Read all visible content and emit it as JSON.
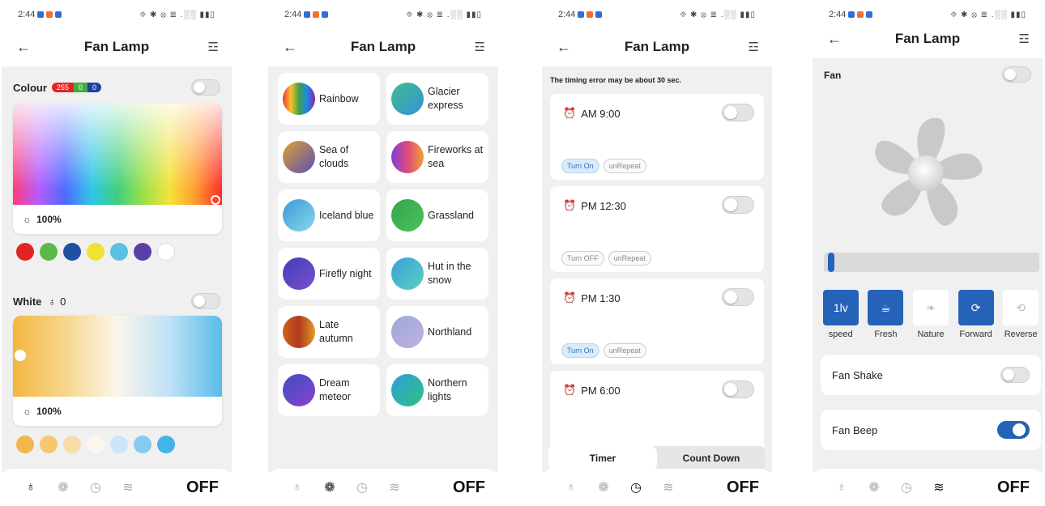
{
  "status": {
    "time": "2:44",
    "icons": "⯑ ✱ ⦻ ≣ .░░ ▮▮▯"
  },
  "app": {
    "title": "Fan Lamp",
    "back_icon": "←",
    "tune_icon": "☲"
  },
  "bottom_nav": {
    "items": [
      "bulb-icon",
      "palette-icon",
      "timer-icon",
      "fan-icon"
    ],
    "off_label": "OFF"
  },
  "color_panel": {
    "colour_label": "Colour",
    "rgb": {
      "r": "255",
      "g": "0",
      "b": "0"
    },
    "colour_brightness": "100%",
    "colour_swatches": [
      "#e32424",
      "#5bb947",
      "#1f4fa0",
      "#f0e233",
      "#5cc0e0",
      "#5a3fa8",
      "#ffffff"
    ],
    "white_label": "White",
    "white_value": "0",
    "white_brightness": "100%",
    "white_swatches": [
      "#f2b64a",
      "#f5c870",
      "#f5dca8",
      "#fbf7ee",
      "#c8e6f6",
      "#86cbee",
      "#45b3e8"
    ]
  },
  "scenes_panel": {
    "scenes": [
      {
        "name": "Rainbow",
        "colors": [
          "#e53935",
          "#fbc02d",
          "#43a047",
          "#1e88e5",
          "#8e24aa"
        ]
      },
      {
        "name": "Glacier express",
        "colors": [
          "#3bbf8a",
          "#3a8fd8"
        ]
      },
      {
        "name": "Sea of clouds",
        "colors": [
          "#e0a030",
          "#5a4fb8"
        ]
      },
      {
        "name": "Fireworks at sea",
        "colors": [
          "#7c3fd8",
          "#e04a7a",
          "#f0a03a"
        ]
      },
      {
        "name": "Iceland blue",
        "colors": [
          "#3a9ad8",
          "#8ad8e8"
        ]
      },
      {
        "name": "Grassland",
        "colors": [
          "#2ea84f",
          "#4fbf5a"
        ]
      },
      {
        "name": "Firefly night",
        "colors": [
          "#3f3fb8",
          "#7a4fd0"
        ]
      },
      {
        "name": "Hut in the snow",
        "colors": [
          "#3aa0d8",
          "#5ad0c0"
        ]
      },
      {
        "name": "Late autumn",
        "colors": [
          "#d0601f",
          "#b03a1f",
          "#e09a2a"
        ]
      },
      {
        "name": "Northland",
        "colors": [
          "#9aaad8",
          "#c0b0e0"
        ]
      },
      {
        "name": "Dream meteor",
        "colors": [
          "#3f4fc0",
          "#8a3fd0"
        ]
      },
      {
        "name": "Northern lights",
        "colors": [
          "#2fa0d8",
          "#2fc080"
        ]
      }
    ]
  },
  "timer_panel": {
    "note": "The timing error may be about 30 sec.",
    "timers": [
      {
        "time": "AM  9:00",
        "action": "Turn On",
        "repeat": "unRepeat"
      },
      {
        "time": "PM  12:30",
        "action": "Turn OFF",
        "repeat": "unRepeat"
      },
      {
        "time": "PM  1:30",
        "action": "Turn On",
        "repeat": "unRepeat"
      },
      {
        "time": "PM  6:00",
        "action": "",
        "repeat": ""
      }
    ],
    "tab_timer": "Timer",
    "tab_countdown": "Count Down"
  },
  "fan_panel": {
    "fan_label": "Fan",
    "speed_level": 0.02,
    "modes": [
      {
        "icon_text": "1lv",
        "label": "speed",
        "active": true
      },
      {
        "icon_text": "☕",
        "label": "Fresh",
        "active": true
      },
      {
        "icon_text": "❧",
        "label": "Nature",
        "active": false
      },
      {
        "icon_text": "⟳",
        "label": "Forward",
        "active": true
      },
      {
        "icon_text": "⟲",
        "label": "Reverse",
        "active": false
      }
    ],
    "fan_shake_label": "Fan Shake",
    "fan_beep_label": "Fan Beep"
  },
  "colors": {
    "accent": "#2563b8",
    "red_chip": "#e32424",
    "green_chip": "#3fae3f",
    "blue_chip": "#1f3fa0"
  }
}
